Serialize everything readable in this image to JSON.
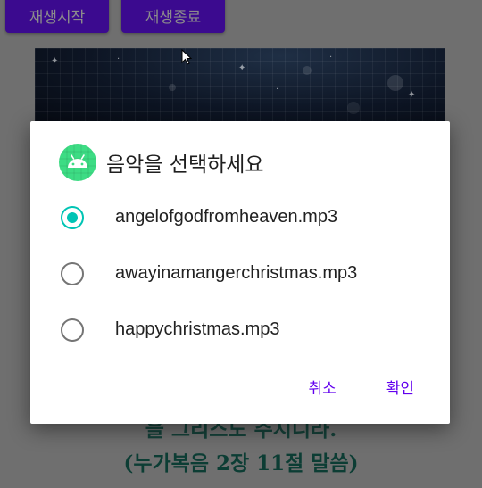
{
  "toolbar": {
    "start_label": "재생시작",
    "stop_label": "재생종료"
  },
  "background": {
    "verse_line1": "을 그리스도 주시니라.",
    "verse_line2": "(누가복음 2장 11절 말씀)"
  },
  "dialog": {
    "icon": "android-icon",
    "title": "음악을 선택하세요",
    "options": [
      {
        "label": "angelofgodfromheaven.mp3",
        "selected": true
      },
      {
        "label": "awayinamangerchristmas.mp3",
        "selected": false
      },
      {
        "label": "happychristmas.mp3",
        "selected": false
      }
    ],
    "cancel_label": "취소",
    "confirm_label": "확인"
  },
  "colors": {
    "accent_radio": "#00c4b4",
    "button_text": "#6200ee",
    "top_button_bg": "#3b0a8f",
    "scrim": "#6f6f6f"
  }
}
